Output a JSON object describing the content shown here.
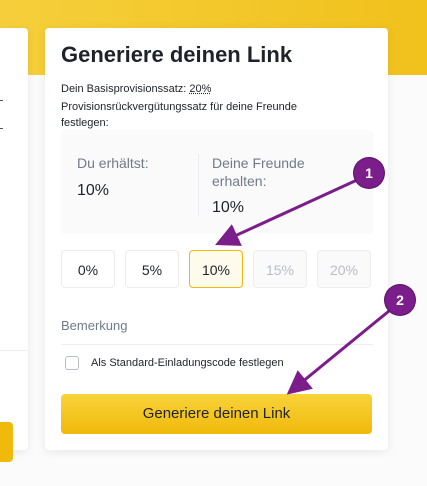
{
  "card": {
    "title": "Generiere deinen Link",
    "rate_prefix": "Dein Basisprovisionssatz: ",
    "rate_value": "20%",
    "description": "Provisionsrückvergütungssatz für deine Freunde festlegen:"
  },
  "share": {
    "you_label": "Du erhältst:",
    "you_value": "10%",
    "friends_label": "Deine Freunde erhalten:",
    "friends_value": "10%"
  },
  "options": [
    {
      "label": "0%",
      "state": "normal"
    },
    {
      "label": "5%",
      "state": "normal"
    },
    {
      "label": "10%",
      "state": "selected"
    },
    {
      "label": "15%",
      "state": "disabled"
    },
    {
      "label": "20%",
      "state": "disabled"
    }
  ],
  "remark": {
    "label": "Bemerkung"
  },
  "default_code": {
    "label": "Als Standard-Einladungscode festlegen",
    "checked": false
  },
  "generate_button": {
    "label": "Generiere deinen Link"
  },
  "annotations": [
    {
      "number": "1",
      "target": "option 10%"
    },
    {
      "number": "2",
      "target": "generate button"
    }
  ],
  "colors": {
    "brand_yellow": "#f0b90b",
    "annotation_purple": "#7b1d8a",
    "selected_bg": "#fefaec",
    "muted_text": "#707a8a"
  }
}
